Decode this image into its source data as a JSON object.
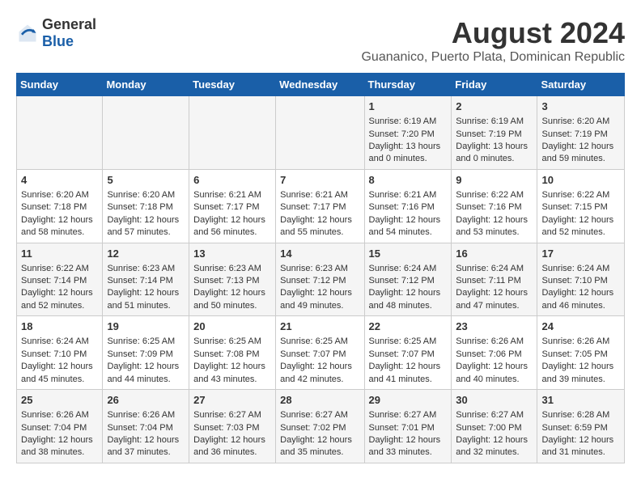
{
  "logo": {
    "text_general": "General",
    "text_blue": "Blue"
  },
  "title": "August 2024",
  "subtitle": "Guananico, Puerto Plata, Dominican Republic",
  "days_of_week": [
    "Sunday",
    "Monday",
    "Tuesday",
    "Wednesday",
    "Thursday",
    "Friday",
    "Saturday"
  ],
  "weeks": [
    [
      {
        "day": "",
        "sunrise": "",
        "sunset": "",
        "daylight": ""
      },
      {
        "day": "",
        "sunrise": "",
        "sunset": "",
        "daylight": ""
      },
      {
        "day": "",
        "sunrise": "",
        "sunset": "",
        "daylight": ""
      },
      {
        "day": "",
        "sunrise": "",
        "sunset": "",
        "daylight": ""
      },
      {
        "day": "1",
        "sunrise": "Sunrise: 6:19 AM",
        "sunset": "Sunset: 7:20 PM",
        "daylight": "Daylight: 13 hours and 0 minutes."
      },
      {
        "day": "2",
        "sunrise": "Sunrise: 6:19 AM",
        "sunset": "Sunset: 7:19 PM",
        "daylight": "Daylight: 13 hours and 0 minutes."
      },
      {
        "day": "3",
        "sunrise": "Sunrise: 6:20 AM",
        "sunset": "Sunset: 7:19 PM",
        "daylight": "Daylight: 12 hours and 59 minutes."
      }
    ],
    [
      {
        "day": "4",
        "sunrise": "Sunrise: 6:20 AM",
        "sunset": "Sunset: 7:18 PM",
        "daylight": "Daylight: 12 hours and 58 minutes."
      },
      {
        "day": "5",
        "sunrise": "Sunrise: 6:20 AM",
        "sunset": "Sunset: 7:18 PM",
        "daylight": "Daylight: 12 hours and 57 minutes."
      },
      {
        "day": "6",
        "sunrise": "Sunrise: 6:21 AM",
        "sunset": "Sunset: 7:17 PM",
        "daylight": "Daylight: 12 hours and 56 minutes."
      },
      {
        "day": "7",
        "sunrise": "Sunrise: 6:21 AM",
        "sunset": "Sunset: 7:17 PM",
        "daylight": "Daylight: 12 hours and 55 minutes."
      },
      {
        "day": "8",
        "sunrise": "Sunrise: 6:21 AM",
        "sunset": "Sunset: 7:16 PM",
        "daylight": "Daylight: 12 hours and 54 minutes."
      },
      {
        "day": "9",
        "sunrise": "Sunrise: 6:22 AM",
        "sunset": "Sunset: 7:16 PM",
        "daylight": "Daylight: 12 hours and 53 minutes."
      },
      {
        "day": "10",
        "sunrise": "Sunrise: 6:22 AM",
        "sunset": "Sunset: 7:15 PM",
        "daylight": "Daylight: 12 hours and 52 minutes."
      }
    ],
    [
      {
        "day": "11",
        "sunrise": "Sunrise: 6:22 AM",
        "sunset": "Sunset: 7:14 PM",
        "daylight": "Daylight: 12 hours and 52 minutes."
      },
      {
        "day": "12",
        "sunrise": "Sunrise: 6:23 AM",
        "sunset": "Sunset: 7:14 PM",
        "daylight": "Daylight: 12 hours and 51 minutes."
      },
      {
        "day": "13",
        "sunrise": "Sunrise: 6:23 AM",
        "sunset": "Sunset: 7:13 PM",
        "daylight": "Daylight: 12 hours and 50 minutes."
      },
      {
        "day": "14",
        "sunrise": "Sunrise: 6:23 AM",
        "sunset": "Sunset: 7:12 PM",
        "daylight": "Daylight: 12 hours and 49 minutes."
      },
      {
        "day": "15",
        "sunrise": "Sunrise: 6:24 AM",
        "sunset": "Sunset: 7:12 PM",
        "daylight": "Daylight: 12 hours and 48 minutes."
      },
      {
        "day": "16",
        "sunrise": "Sunrise: 6:24 AM",
        "sunset": "Sunset: 7:11 PM",
        "daylight": "Daylight: 12 hours and 47 minutes."
      },
      {
        "day": "17",
        "sunrise": "Sunrise: 6:24 AM",
        "sunset": "Sunset: 7:10 PM",
        "daylight": "Daylight: 12 hours and 46 minutes."
      }
    ],
    [
      {
        "day": "18",
        "sunrise": "Sunrise: 6:24 AM",
        "sunset": "Sunset: 7:10 PM",
        "daylight": "Daylight: 12 hours and 45 minutes."
      },
      {
        "day": "19",
        "sunrise": "Sunrise: 6:25 AM",
        "sunset": "Sunset: 7:09 PM",
        "daylight": "Daylight: 12 hours and 44 minutes."
      },
      {
        "day": "20",
        "sunrise": "Sunrise: 6:25 AM",
        "sunset": "Sunset: 7:08 PM",
        "daylight": "Daylight: 12 hours and 43 minutes."
      },
      {
        "day": "21",
        "sunrise": "Sunrise: 6:25 AM",
        "sunset": "Sunset: 7:07 PM",
        "daylight": "Daylight: 12 hours and 42 minutes."
      },
      {
        "day": "22",
        "sunrise": "Sunrise: 6:25 AM",
        "sunset": "Sunset: 7:07 PM",
        "daylight": "Daylight: 12 hours and 41 minutes."
      },
      {
        "day": "23",
        "sunrise": "Sunrise: 6:26 AM",
        "sunset": "Sunset: 7:06 PM",
        "daylight": "Daylight: 12 hours and 40 minutes."
      },
      {
        "day": "24",
        "sunrise": "Sunrise: 6:26 AM",
        "sunset": "Sunset: 7:05 PM",
        "daylight": "Daylight: 12 hours and 39 minutes."
      }
    ],
    [
      {
        "day": "25",
        "sunrise": "Sunrise: 6:26 AM",
        "sunset": "Sunset: 7:04 PM",
        "daylight": "Daylight: 12 hours and 38 minutes."
      },
      {
        "day": "26",
        "sunrise": "Sunrise: 6:26 AM",
        "sunset": "Sunset: 7:04 PM",
        "daylight": "Daylight: 12 hours and 37 minutes."
      },
      {
        "day": "27",
        "sunrise": "Sunrise: 6:27 AM",
        "sunset": "Sunset: 7:03 PM",
        "daylight": "Daylight: 12 hours and 36 minutes."
      },
      {
        "day": "28",
        "sunrise": "Sunrise: 6:27 AM",
        "sunset": "Sunset: 7:02 PM",
        "daylight": "Daylight: 12 hours and 35 minutes."
      },
      {
        "day": "29",
        "sunrise": "Sunrise: 6:27 AM",
        "sunset": "Sunset: 7:01 PM",
        "daylight": "Daylight: 12 hours and 33 minutes."
      },
      {
        "day": "30",
        "sunrise": "Sunrise: 6:27 AM",
        "sunset": "Sunset: 7:00 PM",
        "daylight": "Daylight: 12 hours and 32 minutes."
      },
      {
        "day": "31",
        "sunrise": "Sunrise: 6:28 AM",
        "sunset": "Sunset: 6:59 PM",
        "daylight": "Daylight: 12 hours and 31 minutes."
      }
    ]
  ]
}
